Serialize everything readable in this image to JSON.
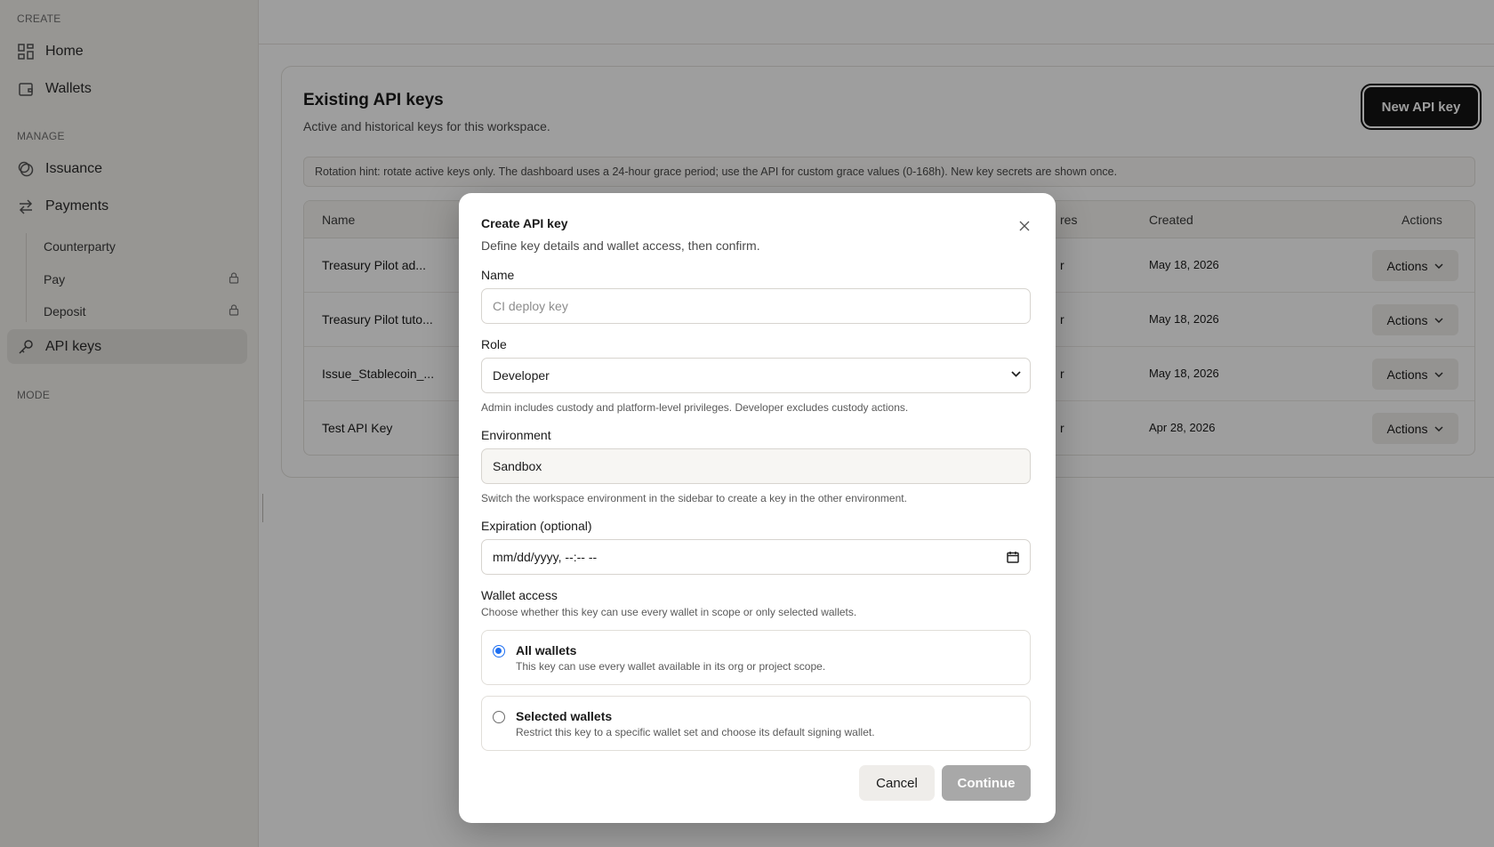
{
  "sidebar": {
    "sections": {
      "create": "CREATE",
      "manage": "MANAGE",
      "mode": "MODE"
    },
    "items": [
      {
        "label": "Home",
        "icon": "grid-icon"
      },
      {
        "label": "Wallets",
        "icon": "wallet-icon"
      },
      {
        "label": "Issuance",
        "icon": "coins-icon"
      },
      {
        "label": "Payments",
        "icon": "arrows-icon"
      },
      {
        "label": "API keys",
        "icon": "key-icon"
      }
    ],
    "sub_items": [
      {
        "label": "Counterparty",
        "locked": false
      },
      {
        "label": "Pay",
        "locked": true
      },
      {
        "label": "Deposit",
        "locked": true
      }
    ]
  },
  "card": {
    "title": "Existing API keys",
    "subtitle": "Active and historical keys for this workspace.",
    "new_button": "New API key",
    "hint": "Rotation hint: rotate active keys only. The dashboard uses a 24-hour grace period; use the API for custom grace values (0-168h). New key secrets are shown once."
  },
  "table": {
    "headers": {
      "name": "Name",
      "expires": "res",
      "created": "Created",
      "actions": "Actions"
    },
    "rows": [
      {
        "name": "Treasury Pilot ad...",
        "expires": "r",
        "created": "May 18, 2026",
        "action": "Actions"
      },
      {
        "name": "Treasury Pilot tuto...",
        "expires": "r",
        "created": "May 18, 2026",
        "action": "Actions"
      },
      {
        "name": "Issue_Stablecoin_...",
        "expires": "r",
        "created": "May 18, 2026",
        "action": "Actions"
      },
      {
        "name": "Test API Key",
        "expires": "r",
        "created": "Apr 28, 2026",
        "action": "Actions"
      }
    ]
  },
  "modal": {
    "title": "Create API key",
    "subtitle": "Define key details and wallet access, then confirm.",
    "name_label": "Name",
    "name_placeholder": "CI deploy key",
    "role_label": "Role",
    "role_value": "Developer",
    "role_help": "Admin includes custody and platform-level privileges. Developer excludes custody actions.",
    "env_label": "Environment",
    "env_value": "Sandbox",
    "env_help": "Switch the workspace environment in the sidebar to create a key in the other environment.",
    "exp_label": "Expiration (optional)",
    "exp_placeholder": "mm/dd/yyyy, --:-- --",
    "wallet_label": "Wallet access",
    "wallet_help": "Choose whether this key can use every wallet in scope or only selected wallets.",
    "options": [
      {
        "title": "All wallets",
        "desc": "This key can use every wallet available in its org or project scope.",
        "selected": true
      },
      {
        "title": "Selected wallets",
        "desc": "Restrict this key to a specific wallet set and choose its default signing wallet.",
        "selected": false
      }
    ],
    "cancel": "Cancel",
    "continue": "Continue"
  },
  "colors": {
    "primary": "#141414",
    "radio_accent": "#1d6ff2",
    "sidebar_bg": "#f4f2ee",
    "disabled": "#a8a8a8"
  }
}
